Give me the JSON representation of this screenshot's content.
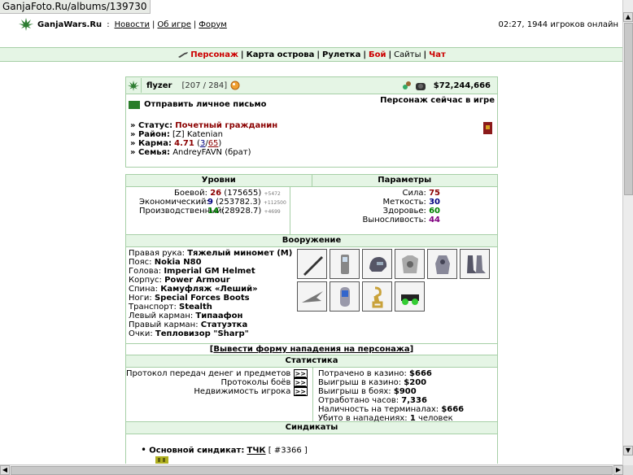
{
  "watermark": "GanjaFoto.Ru/albums/139730",
  "header": {
    "site_name": "GanjaWars.Ru",
    "sep": ":",
    "links": [
      "Новости",
      "Об игре",
      "Форум"
    ],
    "status": "02:27, 1944 игроков онлайн"
  },
  "nav": {
    "items": [
      "Персонаж",
      "Карта острова",
      "Рулетка",
      "Бой",
      "Сайты",
      "Чат"
    ]
  },
  "profile": {
    "nickname": "flyzer",
    "hp": "[207 / 284]",
    "money": "$72,244,666",
    "send_message": "Отправить личное письмо",
    "online_status": "Персонаж сейчас в игре",
    "status_label": "Статус:",
    "status_value": "Почетный гражданин",
    "district_label": "Район:",
    "district_value": "[Z] Katenian",
    "karma_label": "Карма:",
    "karma_value": "4.71",
    "karma_pos": "3",
    "karma_neg": "65",
    "family_label": "Семья:",
    "family_value": "AndreyFAVN (брат)"
  },
  "levels": {
    "title": "Уровни",
    "combat_label": "Боевой:",
    "combat_level": "26",
    "combat_exp": "(175655)",
    "combat_next": "+5472",
    "econ_label": "Экономический:",
    "econ_level": "9",
    "econ_exp": "(253782.3)",
    "econ_next": "+112500",
    "prod_label": "Производственный:",
    "prod_level": "14",
    "prod_exp": "(28928.7)",
    "prod_next": "+4699"
  },
  "params": {
    "title": "Параметры",
    "strength_label": "Сила:",
    "strength": "75",
    "accuracy_label": "Меткость:",
    "accuracy": "30",
    "health_label": "Здоровье:",
    "health": "60",
    "endurance_label": "Выносливость:",
    "endurance": "44"
  },
  "armament": {
    "title": "Вооружение",
    "items": [
      {
        "label": "Правая рука:",
        "value": "Тяжелый миномет (M)"
      },
      {
        "label": "Пояс:",
        "value": "Nokia N80"
      },
      {
        "label": "Голова:",
        "value": "Imperial GM Helmet"
      },
      {
        "label": "Корпус:",
        "value": "Power Armour"
      },
      {
        "label": "Спина:",
        "value": "Камуфляж «Леший»"
      },
      {
        "label": "Ноги:",
        "value": "Special Forces Boots"
      },
      {
        "label": "Транспорт:",
        "value": "Stealth"
      },
      {
        "label": "Левый карман:",
        "value": "Типаафон"
      },
      {
        "label": "Правый карман:",
        "value": "Статуэтка"
      },
      {
        "label": "Очки:",
        "value": "Тепловизор \"Sharp\""
      }
    ]
  },
  "attack_link": "Вывести форму нападения на персонажа",
  "stats": {
    "title": "Статистика",
    "left": [
      "Протокол передач денег и предметов",
      "Протоколы боёв",
      "Недвижимость игрока"
    ],
    "arrow": ">>",
    "spent_label": "Потрачено в казино:",
    "spent": "$666",
    "win_casino_label": "Выигрыш в казино:",
    "win_casino": "$200",
    "win_battle_label": "Выигрыш в боях:",
    "win_battle": "$900",
    "hours_label": "Отработано часов:",
    "hours": "7,336",
    "cash_label": "Наличность на терминалах:",
    "cash": "$666",
    "kills_label": "Убито в нападениях:",
    "kills": "1",
    "kills_unit": "человек"
  },
  "syndicates": {
    "title": "Синдикаты",
    "main_label": "Основной синдикат:",
    "name": "ТЧК",
    "number": "[ #3366 ]"
  },
  "colors": {
    "panel_bg": "#e5f5e5",
    "border": "#a6cfa6",
    "accent_red": "#cc0000"
  }
}
